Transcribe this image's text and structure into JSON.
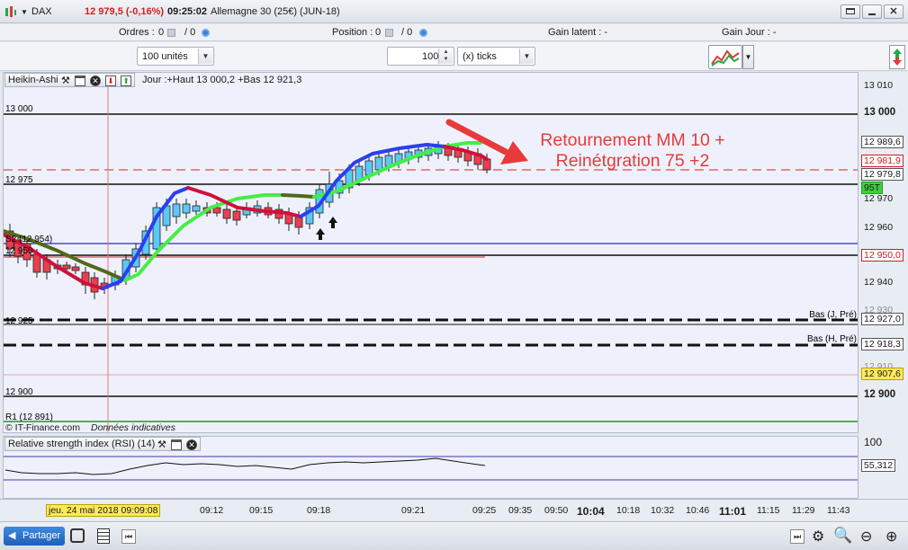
{
  "titlebar": {
    "instrument": "DAX",
    "quote": "12 979,5 (-0,16%)",
    "time": "09:25:02",
    "contract": "Allemagne 30 (25€) (JUN-18)"
  },
  "infobar": {
    "orders_label": "Ordres :",
    "orders_value": "0",
    "orders_slash": "/ 0",
    "position_label": "Position :",
    "position_value": "0",
    "position_slash": "/ 0",
    "gain_latent": "Gain latent :  -",
    "gain_jour": "Gain Jour :  -"
  },
  "toolbar": {
    "units_select": "100 unités",
    "ticks_input": "100",
    "ticks_select": "(x) ticks"
  },
  "chart_panel": {
    "indicator_name": "Heikin-Ashi",
    "bar_info": "Jour :+Haut 13 000,2 +Bas 12 921,3",
    "copyright": "© IT-Finance.com",
    "disclaimer": "Données indicatives"
  },
  "annotation": {
    "line1": "Retournement MM 10 +",
    "line2": "Reinétgration 75 +2"
  },
  "level_labels": {
    "l13000": "13 000",
    "l12975": "12 975",
    "l12954": "S2 (12 954)",
    "l12950": "12 950",
    "l12925": "12 925",
    "l12900": "12 900",
    "r1": "R1 (12 891)",
    "bas_j": "Bas (J, Pré)",
    "bas_h": "Bas (H, Pré)"
  },
  "price_axis": {
    "ticks": [
      "13 010",
      "13 000",
      "12 970",
      "12 960",
      "12 940",
      "12 930",
      "12 910",
      "12 900"
    ],
    "markers": {
      "m1": "12 989,6",
      "m2": "12 981,9",
      "m3": "12 979,8",
      "m4": "95T",
      "m5": "12 950,0",
      "m6": "12 927,0",
      "m7": "12 918,3",
      "m8": "12 907,6"
    }
  },
  "rsi_panel": {
    "title": "Relative strength index (RSI) (14)",
    "axis_top": "100",
    "value": "55,312"
  },
  "time_axis": {
    "cursor_label": "jeu. 24 mai 2018 09:09:08",
    "labels": [
      "09:12",
      "09:15",
      "09:18",
      "09:21",
      "09:25",
      "09:35",
      "09:50",
      "10:04",
      "10:18",
      "10:32",
      "10:46",
      "11:01",
      "11:15",
      "11:29",
      "11:43"
    ]
  },
  "bottombar": {
    "share_label": "Partager"
  },
  "colors": {
    "candle_up": "#5bc8f5",
    "candle_down": "#e8404f",
    "ma_fast_up": "#2b3ff0",
    "ma_fast_down": "#d0103a",
    "ma_slow_up": "#44ee44",
    "ma_slow_down": "#4e6a1a",
    "annotation": "#e83a3a"
  }
}
